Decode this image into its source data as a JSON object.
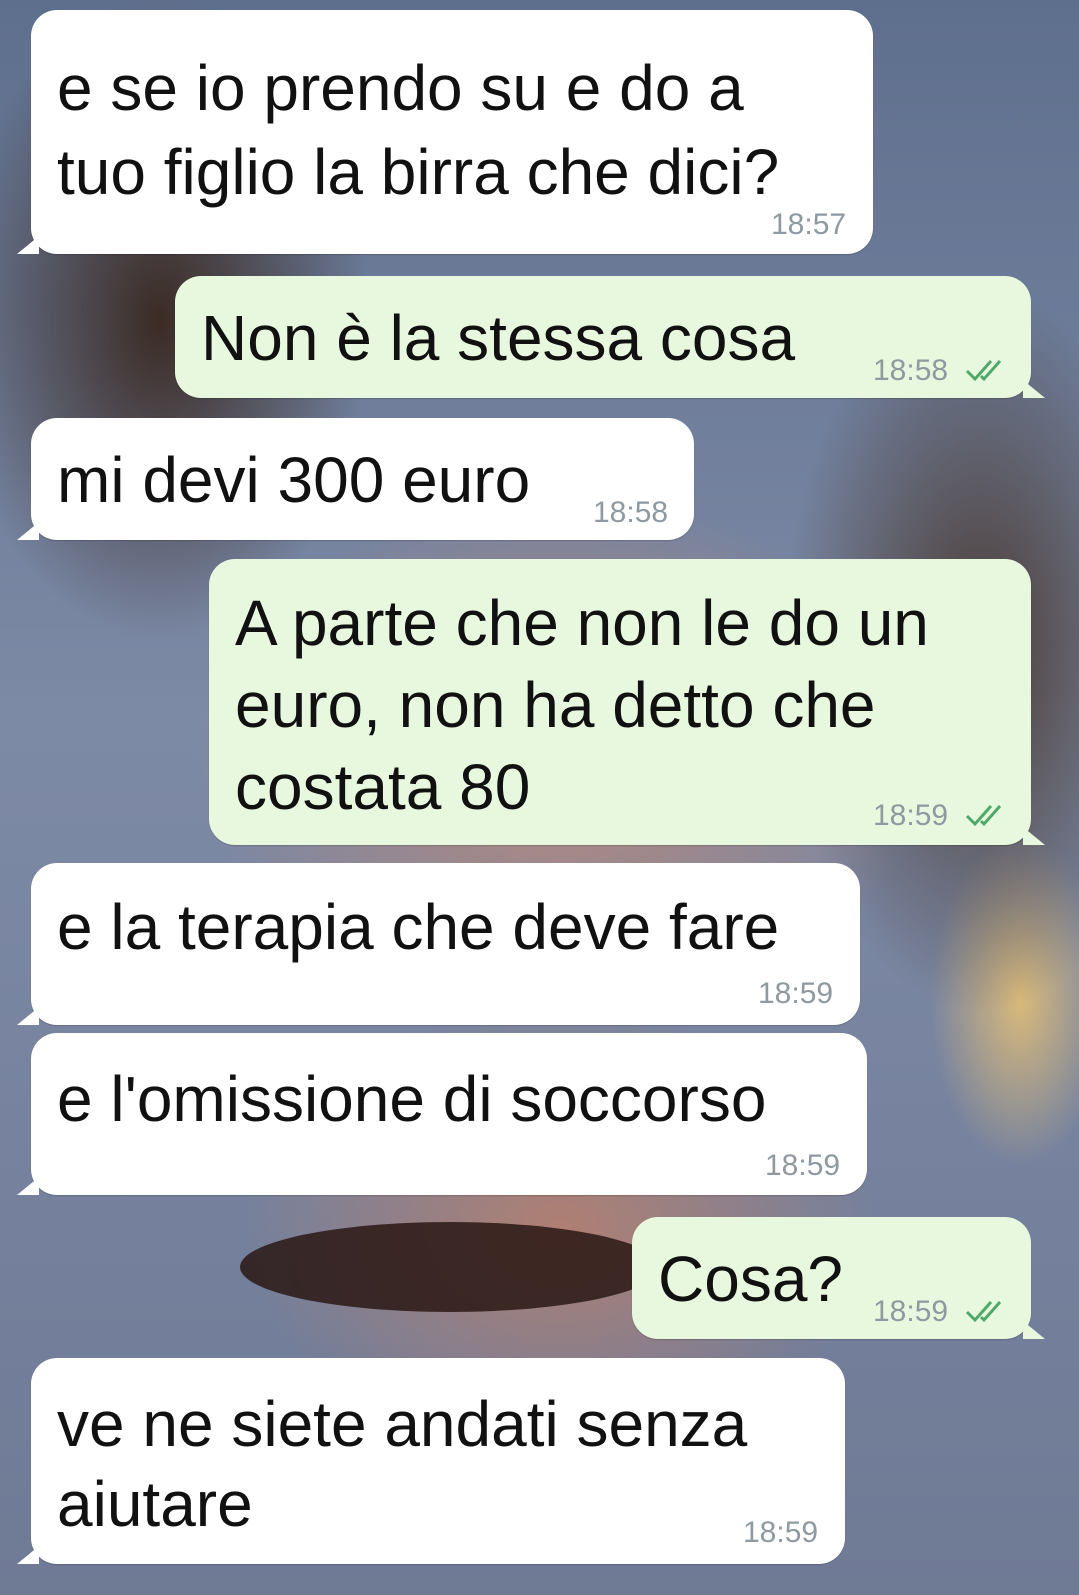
{
  "chat": {
    "messages": [
      {
        "direction": "in",
        "lines": [
          "e se io prendo su e do a",
          "tuo figlio la birra che dici?"
        ],
        "time": "18:57"
      },
      {
        "direction": "out",
        "lines": [
          "Non è la stessa cosa"
        ],
        "time": "18:58",
        "status": "read"
      },
      {
        "direction": "in",
        "lines": [
          "mi devi 300 euro"
        ],
        "time": "18:58"
      },
      {
        "direction": "out",
        "lines": [
          "A parte che non le do un",
          "euro, non ha detto che",
          "costata 80"
        ],
        "time": "18:59",
        "status": "read"
      },
      {
        "direction": "in",
        "lines": [
          "e la terapia che deve fare"
        ],
        "time": "18:59"
      },
      {
        "direction": "in",
        "lines": [
          "e l'omissione di soccorso"
        ],
        "time": "18:59"
      },
      {
        "direction": "out",
        "lines": [
          "Cosa?"
        ],
        "time": "18:59",
        "status": "read"
      },
      {
        "direction": "in",
        "lines": [
          "ve ne siete andati senza",
          "aiutare"
        ],
        "time": "18:59"
      }
    ]
  },
  "colors": {
    "incoming_bubble": "#ffffff",
    "outgoing_bubble": "#e8f8df",
    "timestamp": "#8e9aa0",
    "read_ticks": "#4fa86a"
  },
  "icons": {
    "read_receipt": "double-check-icon"
  }
}
